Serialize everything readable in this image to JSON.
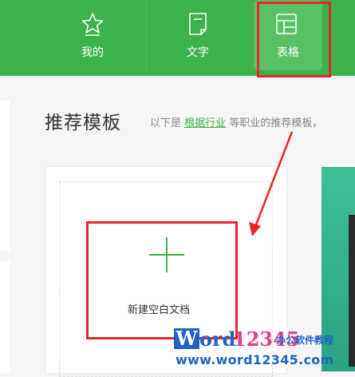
{
  "nav": {
    "tabs": [
      {
        "label": "我的",
        "icon": "star-icon"
      },
      {
        "label": "文字",
        "icon": "document-icon"
      },
      {
        "label": "表格",
        "icon": "table-icon",
        "active": true
      }
    ],
    "bar_color": "#3cb34a"
  },
  "section": {
    "title": "推荐模板",
    "desc_before": "以下是",
    "desc_link": "根据行业",
    "desc_after": "等职业的推荐模板，"
  },
  "card": {
    "new_label": "新建空白文档",
    "icon": "plus-icon"
  },
  "watermark": {
    "w": "W",
    "ord": "ord",
    "num": "12345",
    "tag": "办公软件教程",
    "url": "www.word12345.com"
  },
  "colors": {
    "highlight": "#e8262c",
    "accent": "#3cb34a"
  }
}
